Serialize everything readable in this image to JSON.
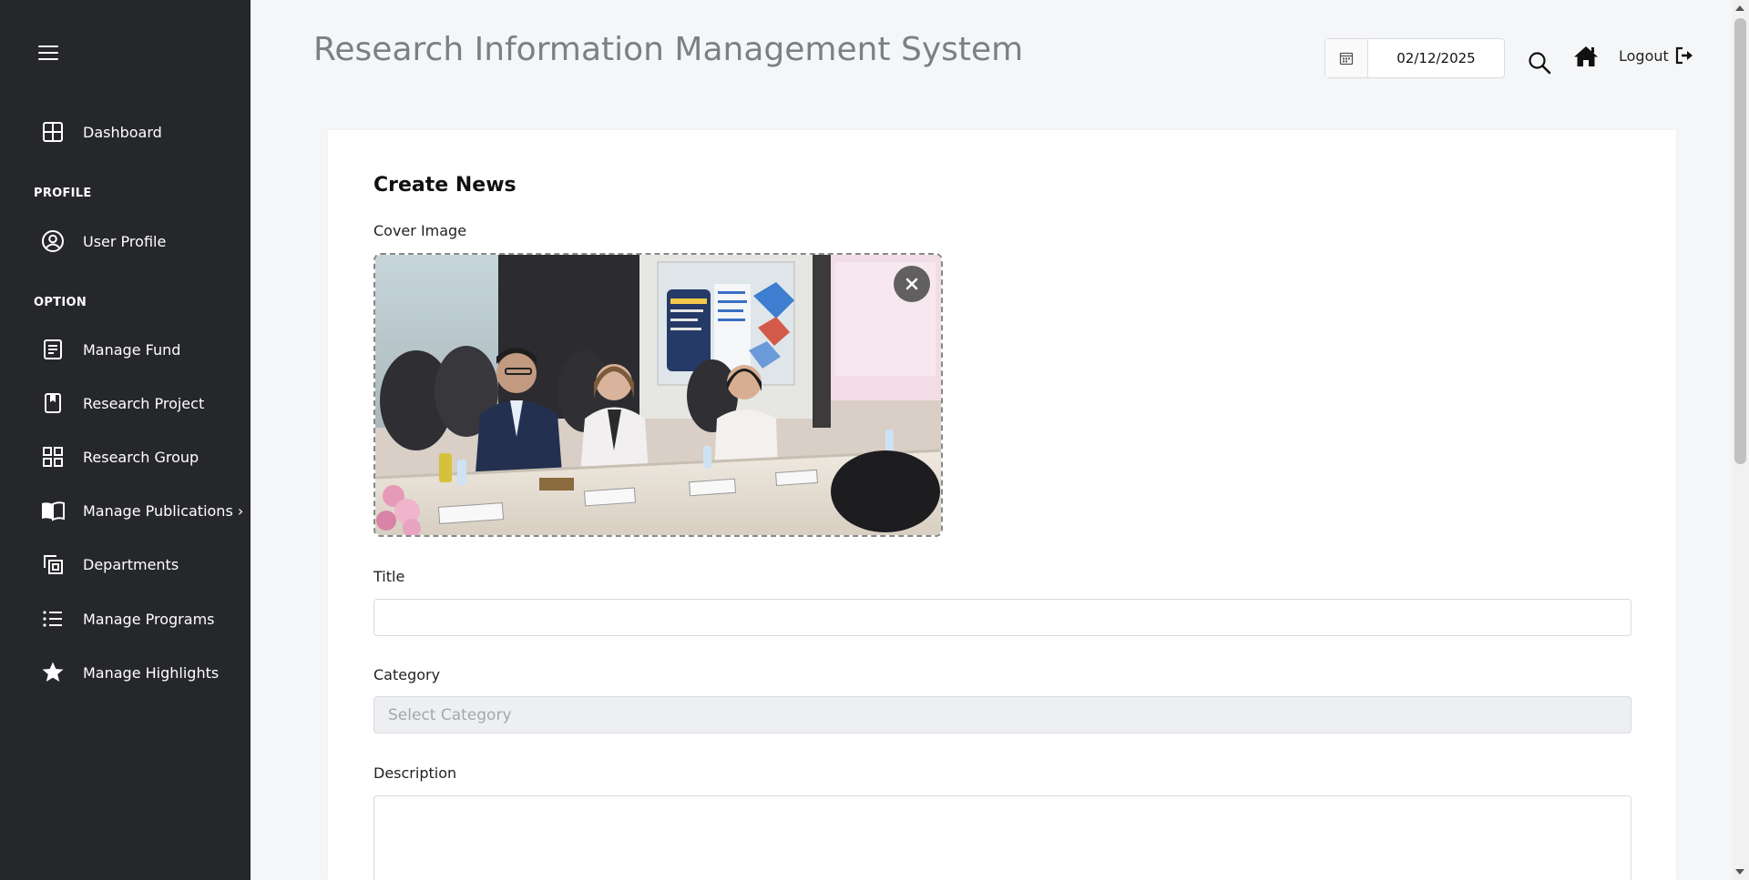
{
  "app": {
    "title": "Research Information Management System"
  },
  "sidebar": {
    "items": [
      {
        "label": "Dashboard",
        "icon": "dashboard-icon"
      },
      {
        "label": "User Profile",
        "icon": "user-circle-icon"
      },
      {
        "label": "Manage Fund",
        "icon": "document-icon"
      },
      {
        "label": "Research Project",
        "icon": "bookmark-icon"
      },
      {
        "label": "Research Group",
        "icon": "grid-icon"
      },
      {
        "label": "Manage Publications",
        "icon": "book-open-icon",
        "chevron": "›"
      },
      {
        "label": "Departments",
        "icon": "copy-icon"
      },
      {
        "label": "Manage Programs",
        "icon": "list-icon"
      },
      {
        "label": "Manage Highlights",
        "icon": "star-icon"
      }
    ],
    "sections": {
      "profile": "PROFILE",
      "option": "OPTION"
    }
  },
  "header": {
    "date": "02/12/2025",
    "logout_label": "Logout"
  },
  "form": {
    "title": "Create News",
    "cover_label": "Cover Image",
    "title_label": "Title",
    "title_value": "",
    "category_label": "Category",
    "category_placeholder": "Select Category",
    "description_label": "Description"
  },
  "colors": {
    "sidebar_bg": "#26272b",
    "page_bg": "#f5f6f8",
    "title_gray": "#7d7f84"
  }
}
